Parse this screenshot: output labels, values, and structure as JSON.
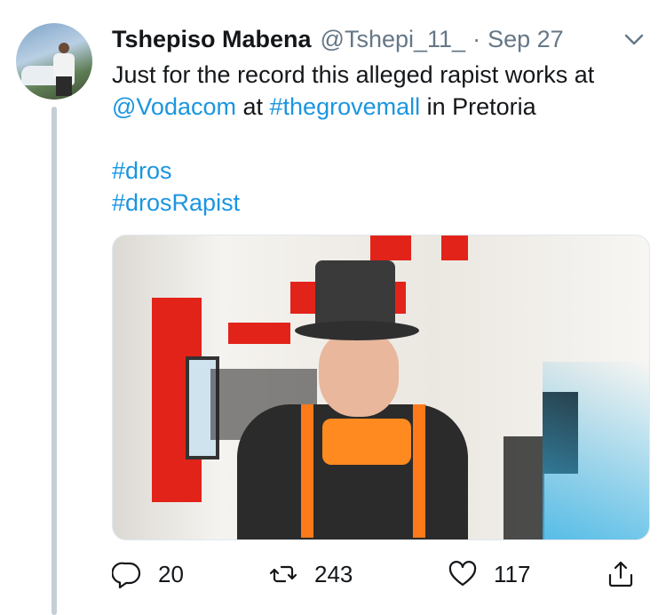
{
  "tweet": {
    "author_name": "Tshepiso Mabena",
    "author_handle": "@Tshepi_11_",
    "separator": "·",
    "date": "Sep 27",
    "line1_text": "Just for the record this alleged rapist works at",
    "mention": "@Vodacom",
    "at_word": " at ",
    "hashtag_place": "#thegrovemall",
    "in_text": " in Pretoria",
    "hashtag_1": "#dros",
    "hashtag_2": "#drosRapist"
  },
  "actions": {
    "reply_count": "20",
    "retweet_count": "243",
    "like_count": "117"
  },
  "icons": {
    "menu": "chevron-down-icon",
    "reply": "reply-icon",
    "retweet": "retweet-icon",
    "like": "heart-icon",
    "share": "share-icon"
  },
  "colors": {
    "link": "#1b95e0",
    "secondary_text": "#657786",
    "thread_line": "#c4cfd6"
  }
}
